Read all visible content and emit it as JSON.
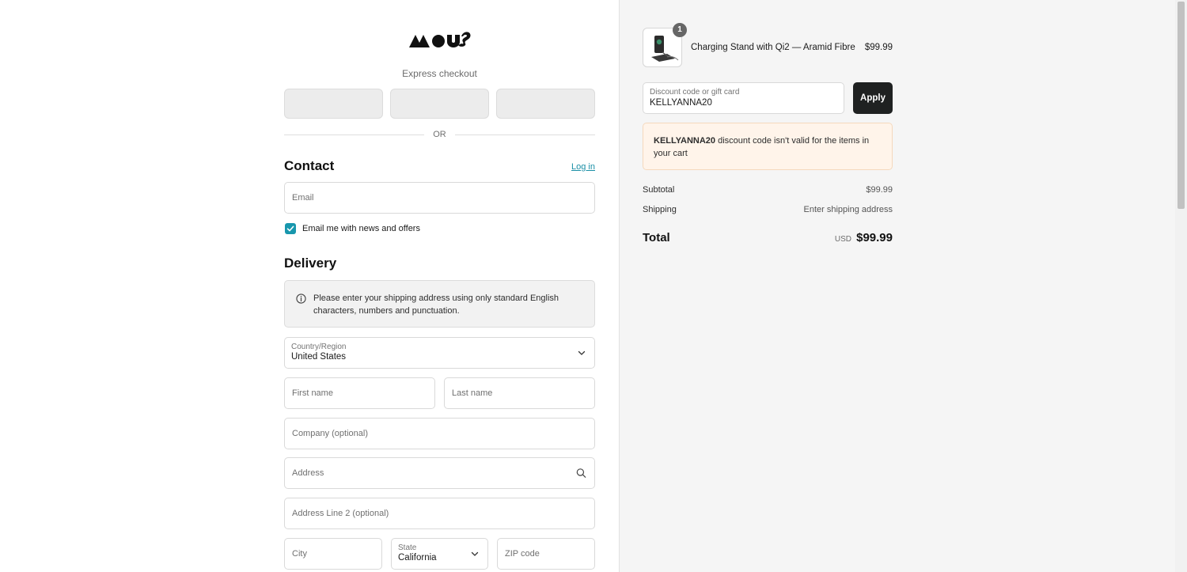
{
  "brand": {
    "logo_name": "mous-logo"
  },
  "express": {
    "label": "Express checkout",
    "divider": "OR"
  },
  "contact": {
    "title": "Contact",
    "login_link": "Log in",
    "email_placeholder": "Email",
    "newsletter_label": "Email me with news and offers",
    "newsletter_checked": true
  },
  "delivery": {
    "title": "Delivery",
    "notice": "Please enter your shipping address using only standard English characters, numbers and punctuation.",
    "country_label": "Country/Region",
    "country_value": "United States",
    "first_name_placeholder": "First name",
    "last_name_placeholder": "Last name",
    "company_placeholder": "Company (optional)",
    "address_placeholder": "Address",
    "address2_placeholder": "Address Line 2 (optional)",
    "city_placeholder": "City",
    "state_label": "State",
    "state_value": "California",
    "zip_placeholder": "ZIP code"
  },
  "summary": {
    "item": {
      "name": "Charging Stand with Qi2 — Aramid Fibre",
      "price": "$99.99",
      "quantity": "1"
    },
    "discount_label": "Discount code or gift card",
    "discount_value": "KELLYANNA20",
    "apply_label": "Apply",
    "error_code": "KELLYANNA20",
    "error_message": " discount code isn't valid for the items in your cart",
    "subtotal_label": "Subtotal",
    "subtotal_value": "$99.99",
    "shipping_label": "Shipping",
    "shipping_value": "Enter shipping address",
    "total_label": "Total",
    "total_currency": "USD",
    "total_value": "$99.99"
  },
  "colors": {
    "accent": "#1897ad",
    "link": "#1a8fa6",
    "apply_bg": "#1f2121",
    "error_bg": "#fff4ea"
  }
}
